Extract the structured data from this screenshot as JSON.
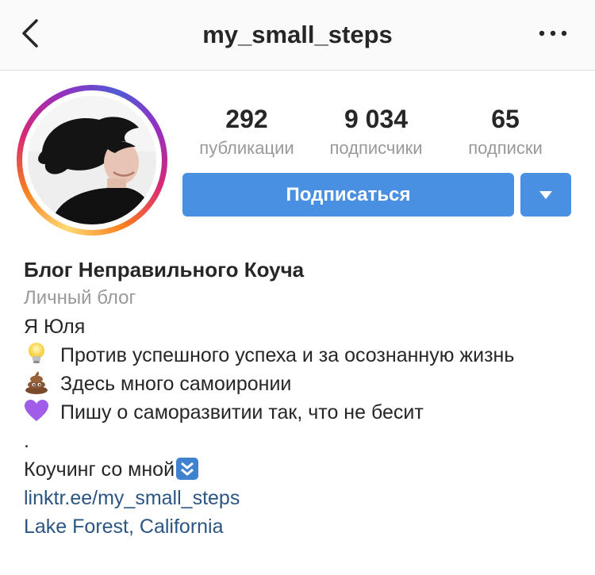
{
  "header": {
    "username": "my_small_steps",
    "back_icon": "chevron-left-icon",
    "more_icon": "more-horizontal-icon"
  },
  "stats": [
    {
      "value": "292",
      "label": "публикации"
    },
    {
      "value": "9 034",
      "label": "подписчики"
    },
    {
      "value": "65",
      "label": "подписки"
    }
  ],
  "actions": {
    "follow_label": "Подписаться",
    "dropdown_icon": "caret-down-icon"
  },
  "bio": {
    "name": "Блог Неправильного Коуча",
    "category": "Личный блог",
    "lines": [
      {
        "icon": "",
        "text": "Я Юля"
      },
      {
        "icon": "light-bulb-icon",
        "text": "Против успешного успеха и за осознанную жизнь"
      },
      {
        "icon": "pile-of-poo-icon",
        "text": "Здесь много самоиронии"
      },
      {
        "icon": "purple-heart-icon",
        "text": "Пишу о саморазвитии так, что не бесит"
      },
      {
        "icon": "",
        "text": "."
      },
      {
        "icon": "double-down-arrow-icon",
        "text": "Коучинг со мной"
      }
    ],
    "link": "linktr.ee/my_small_steps",
    "location": "Lake Forest, California"
  },
  "colors": {
    "follow_button": "#4a90e2",
    "link": "#2b5583",
    "secondary_text": "#999999"
  }
}
